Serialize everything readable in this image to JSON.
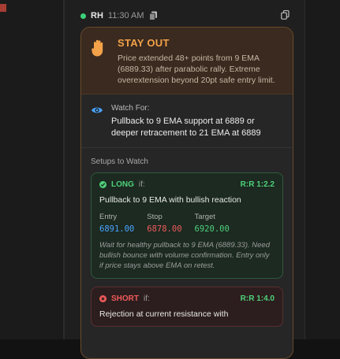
{
  "header": {
    "author": "RH",
    "timestamp": "11:30 AM"
  },
  "alert": {
    "title": "STAY OUT",
    "body": "Price extended 48+ points from 9 EMA (6889.33) after parabolic rally. Extreme overextension beyond 20pt safe entry limit.",
    "icon": "hand-icon"
  },
  "watch": {
    "label": "Watch For:",
    "text": "Pullback to 9 EMA support at 6889 or deeper retracement to 21 EMA at 6889",
    "icon": "eye-icon"
  },
  "setups_heading": "Setups to Watch",
  "setups": [
    {
      "direction": "LONG",
      "if_label": "if:",
      "rr": "R:R 1:2.2",
      "description": "Pullback to 9 EMA with bullish reaction",
      "entry_label": "Entry",
      "entry": "6891.00",
      "stop_label": "Stop",
      "stop": "6878.00",
      "target_label": "Target",
      "target": "6920.00",
      "note": "Wait for healthy pullback to 9 EMA (6889.33). Need bullish bounce with volume confirmation. Entry only if price stays above EMA on retest."
    },
    {
      "direction": "SHORT",
      "if_label": "if:",
      "rr": "R:R 1:4.0",
      "description": "Rejection at current resistance with"
    }
  ],
  "colors": {
    "accent_orange": "#f3a24a",
    "long_green": "#4ed07a",
    "short_red": "#ee5a5a",
    "entry_blue": "#4aa3ff"
  }
}
